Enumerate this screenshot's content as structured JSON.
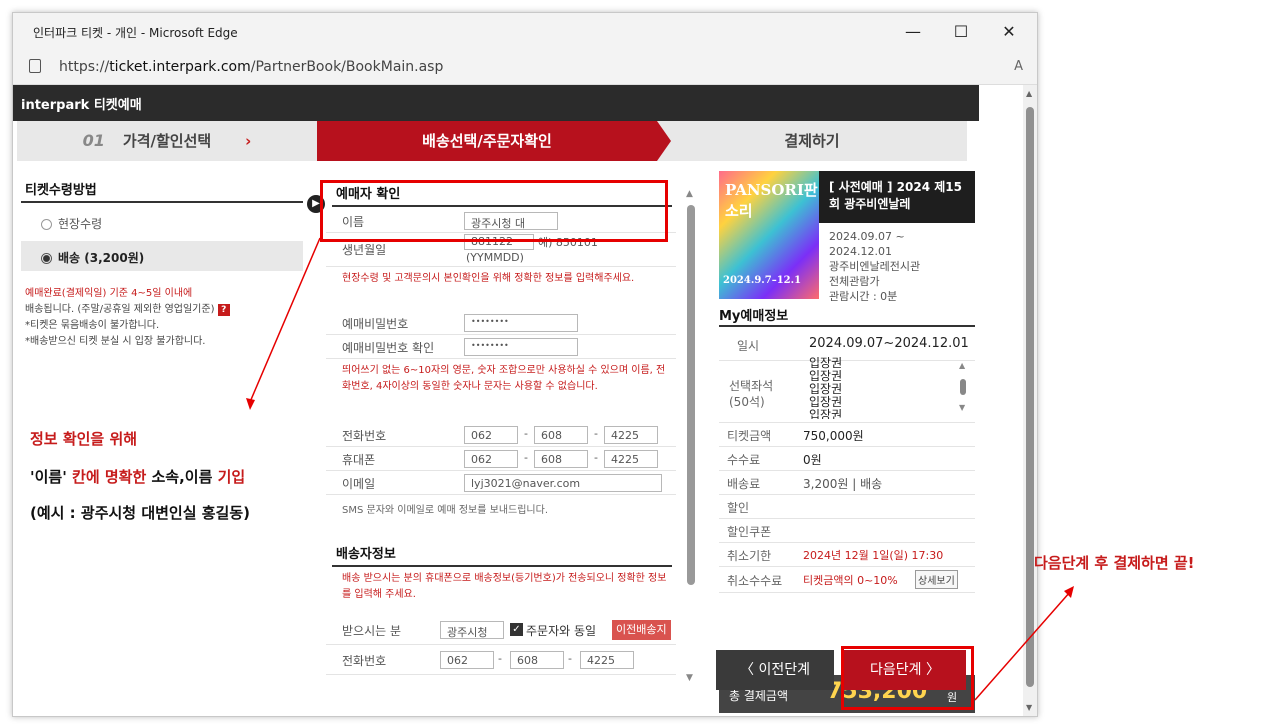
{
  "window": {
    "title": "인터파크 티켓 - 개인 - Microsoft Edge",
    "url_prefix": "https://",
    "url_host": "ticket.interpark.com",
    "url_path": "/PartnerBook/BookMain.asp",
    "read_aloud": "A",
    "minimize": "—",
    "maximize": "☐",
    "close": "✕"
  },
  "brand": {
    "logo": "interpark 티켓예매"
  },
  "steps": {
    "step1_num": "01",
    "step1": "가격/할인선택",
    "step1_arrow": "›",
    "step2": "배송선택/주문자확인",
    "step3": "결제하기"
  },
  "delivery_method": {
    "title": "티켓수령방법",
    "option1": "현장수령",
    "option2": "배송 (3,200원)",
    "note_red1": "예매완료(결제익일) 기준 4~5일 이내에",
    "note_2": "배송됩니다. (주말/공휴일 제외한 영업일기준)",
    "note_q": "?",
    "note_3": "*티켓은 묶음배송이 불가합니다.",
    "note_4": "*배송받으신 티켓 분실 시 입장 불가합니다."
  },
  "booker": {
    "title": "예매자 확인",
    "name_label": "이름",
    "name_value": "광주시청 대",
    "birth_label": "생년월일",
    "birth_value": "881122",
    "birth_hint": "예) 850101",
    "birth_format": "(YYMMDD)",
    "notice": "현장수령 및 고객문의시 본인확인을 위해 정확한 정보를 입력해주세요.",
    "pw_label": "예매비밀번호",
    "pw_value": "••••••••",
    "pw_confirm_label": "예매비밀번호 확인",
    "pw_confirm_value": "••••••••",
    "pw_rule": "띄어쓰기 없는 6~10자의 영문, 숫자 조합으로만 사용하실 수 있으며 이름, 전화번호, 4자이상의 동일한 숫자나 문자는 사용할 수 없습니다.",
    "phone_label": "전화번호",
    "phone": [
      "062",
      "608",
      "4225"
    ],
    "mobile_label": "휴대폰",
    "mobile": [
      "062",
      "608",
      "4225"
    ],
    "email_label": "이메일",
    "email": "lyj3021@naver.com",
    "sms_note": "SMS 문자와 이메일로 예매 정보를 보내드립니다."
  },
  "recipient": {
    "title": "배송자정보",
    "notice": "배송 받으시는 분의 휴대폰으로 배송정보(등기번호)가 전송되오니 정확한 정보를 입력해 주세요.",
    "name_label": "받으시는 분",
    "name_value": "광주시청",
    "same_label": "주문자와 동일",
    "prev_addr": "이전배송지",
    "phone_label": "전화번호",
    "phone": [
      "062",
      "608",
      "4225"
    ]
  },
  "event": {
    "poster_top": "PANSORI판소리",
    "poster_bottom": "2024.9.7–12.1",
    "title": "[ 사전예매 ] 2024 제15회 광주비엔날레",
    "dates": "2024.09.07 ~",
    "dates2": "2024.12.01",
    "venue": "광주비엔날레전시관",
    "rating": "전체관람가",
    "runtime": "관람시간 : 0분"
  },
  "my_booking": {
    "title": "My예매정보",
    "date_label": "일시",
    "date_value": "2024.09.07~2024.12.01",
    "seat_label": "선택좌석",
    "seat_count": "(50석)",
    "seats": [
      "입장권",
      "입장권",
      "입장권",
      "입장권",
      "입장권"
    ],
    "price_label": "티켓금액",
    "price_value": "750,000원",
    "fee_label": "수수료",
    "fee_value": "0원",
    "ship_label": "배송료",
    "ship_value": "3,200원 | 배송",
    "discount_label": "할인",
    "coupon_label": "할인쿠폰",
    "cancel_label": "취소기한",
    "cancel_value": "2024년 12월 1일(일) 17:30",
    "cancel_fee_label": "취소수수료",
    "cancel_fee_value": "티켓금액의 0~10%",
    "detail_btn": "상세보기",
    "total_label": "총 결제금액",
    "total_value": "753,200",
    "total_unit": "원"
  },
  "buttons": {
    "prev": "〈  이전단계",
    "next": "다음단계  〉"
  },
  "annotations": {
    "left1": "정보 확인을 위해",
    "left2a": "'이름' ",
    "left2b": "칸에 명확한",
    "left2c": " 소속,이름 ",
    "left2d": "기입",
    "left3": "(예시 : 광주시청 대변인실 홍길동)",
    "right": "다음단계 후 결제하면 끝!"
  },
  "colors": {
    "accent_red": "#b7111d",
    "annotation_red": "#e60000",
    "dark": "#2b2b2b"
  }
}
